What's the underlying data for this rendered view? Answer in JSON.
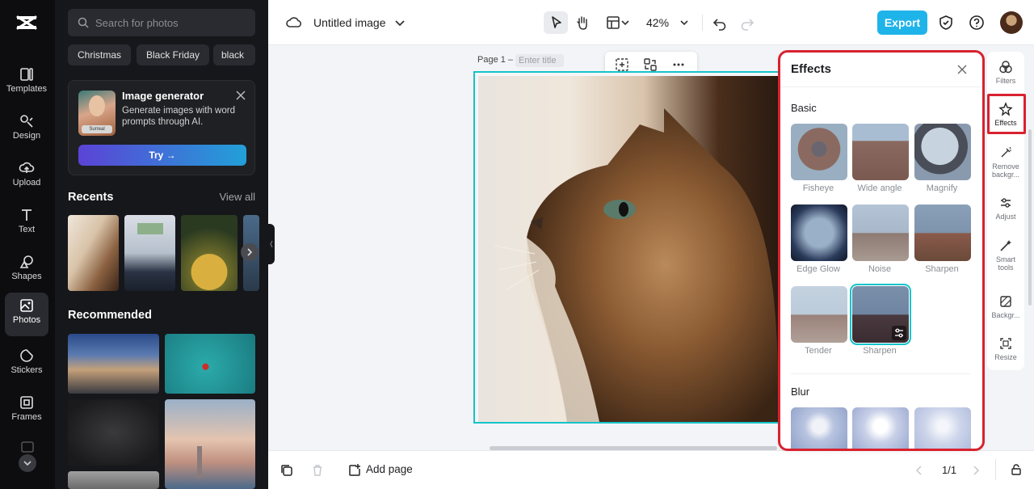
{
  "rail": {
    "items": [
      {
        "label": "Templates",
        "icon": "templates-icon"
      },
      {
        "label": "Design",
        "icon": "design-icon"
      },
      {
        "label": "Upload",
        "icon": "upload-icon"
      },
      {
        "label": "Text",
        "icon": "text-icon"
      },
      {
        "label": "Shapes",
        "icon": "shapes-icon"
      },
      {
        "label": "Photos",
        "icon": "photos-icon",
        "active": true
      },
      {
        "label": "Stickers",
        "icon": "stickers-icon"
      },
      {
        "label": "Frames",
        "icon": "frames-icon"
      }
    ]
  },
  "panel": {
    "search_placeholder": "Search for photos",
    "chips": [
      "Christmas",
      "Black Friday",
      "black"
    ],
    "promo": {
      "title": "Image generator",
      "description": "Generate images with word prompts through AI.",
      "thumb_tag": "Surreal",
      "button": "Try →"
    },
    "recents_title": "Recents",
    "view_all": "View all",
    "recommended_title": "Recommended"
  },
  "topbar": {
    "title": "Untitled image",
    "zoom": "42%",
    "export": "Export"
  },
  "canvas": {
    "page_label": "Page 1 –",
    "page_title_placeholder": "Enter title"
  },
  "bottombar": {
    "add_page": "Add page",
    "pager": "1/1"
  },
  "effects": {
    "title": "Effects",
    "sections": [
      {
        "name": "Basic",
        "items": [
          "Fisheye",
          "Wide angle",
          "Magnify",
          "Edge Glow",
          "Noise",
          "Sharpen",
          "Tender",
          "Sharpen"
        ],
        "selected_index": 7
      },
      {
        "name": "Blur",
        "items": [
          "",
          "",
          ""
        ]
      }
    ]
  },
  "rightbar": {
    "items": [
      {
        "label": "Filters",
        "icon": "filters-icon"
      },
      {
        "label": "Effects",
        "icon": "effects-icon",
        "active": true
      },
      {
        "label": "Remove backgr...",
        "icon": "remove-background-icon"
      },
      {
        "label": "Adjust",
        "icon": "adjust-icon"
      },
      {
        "label": "Smart tools",
        "icon": "smart-tools-icon"
      },
      {
        "label": "Backgr...",
        "icon": "background-icon"
      },
      {
        "label": "Resize",
        "icon": "resize-icon"
      }
    ]
  },
  "colors": {
    "accent": "#1fb4e9",
    "selection": "#14c4c9",
    "highlight": "#d8222f",
    "rail_bg": "#0d0d0f",
    "panel_bg": "#16171b"
  }
}
